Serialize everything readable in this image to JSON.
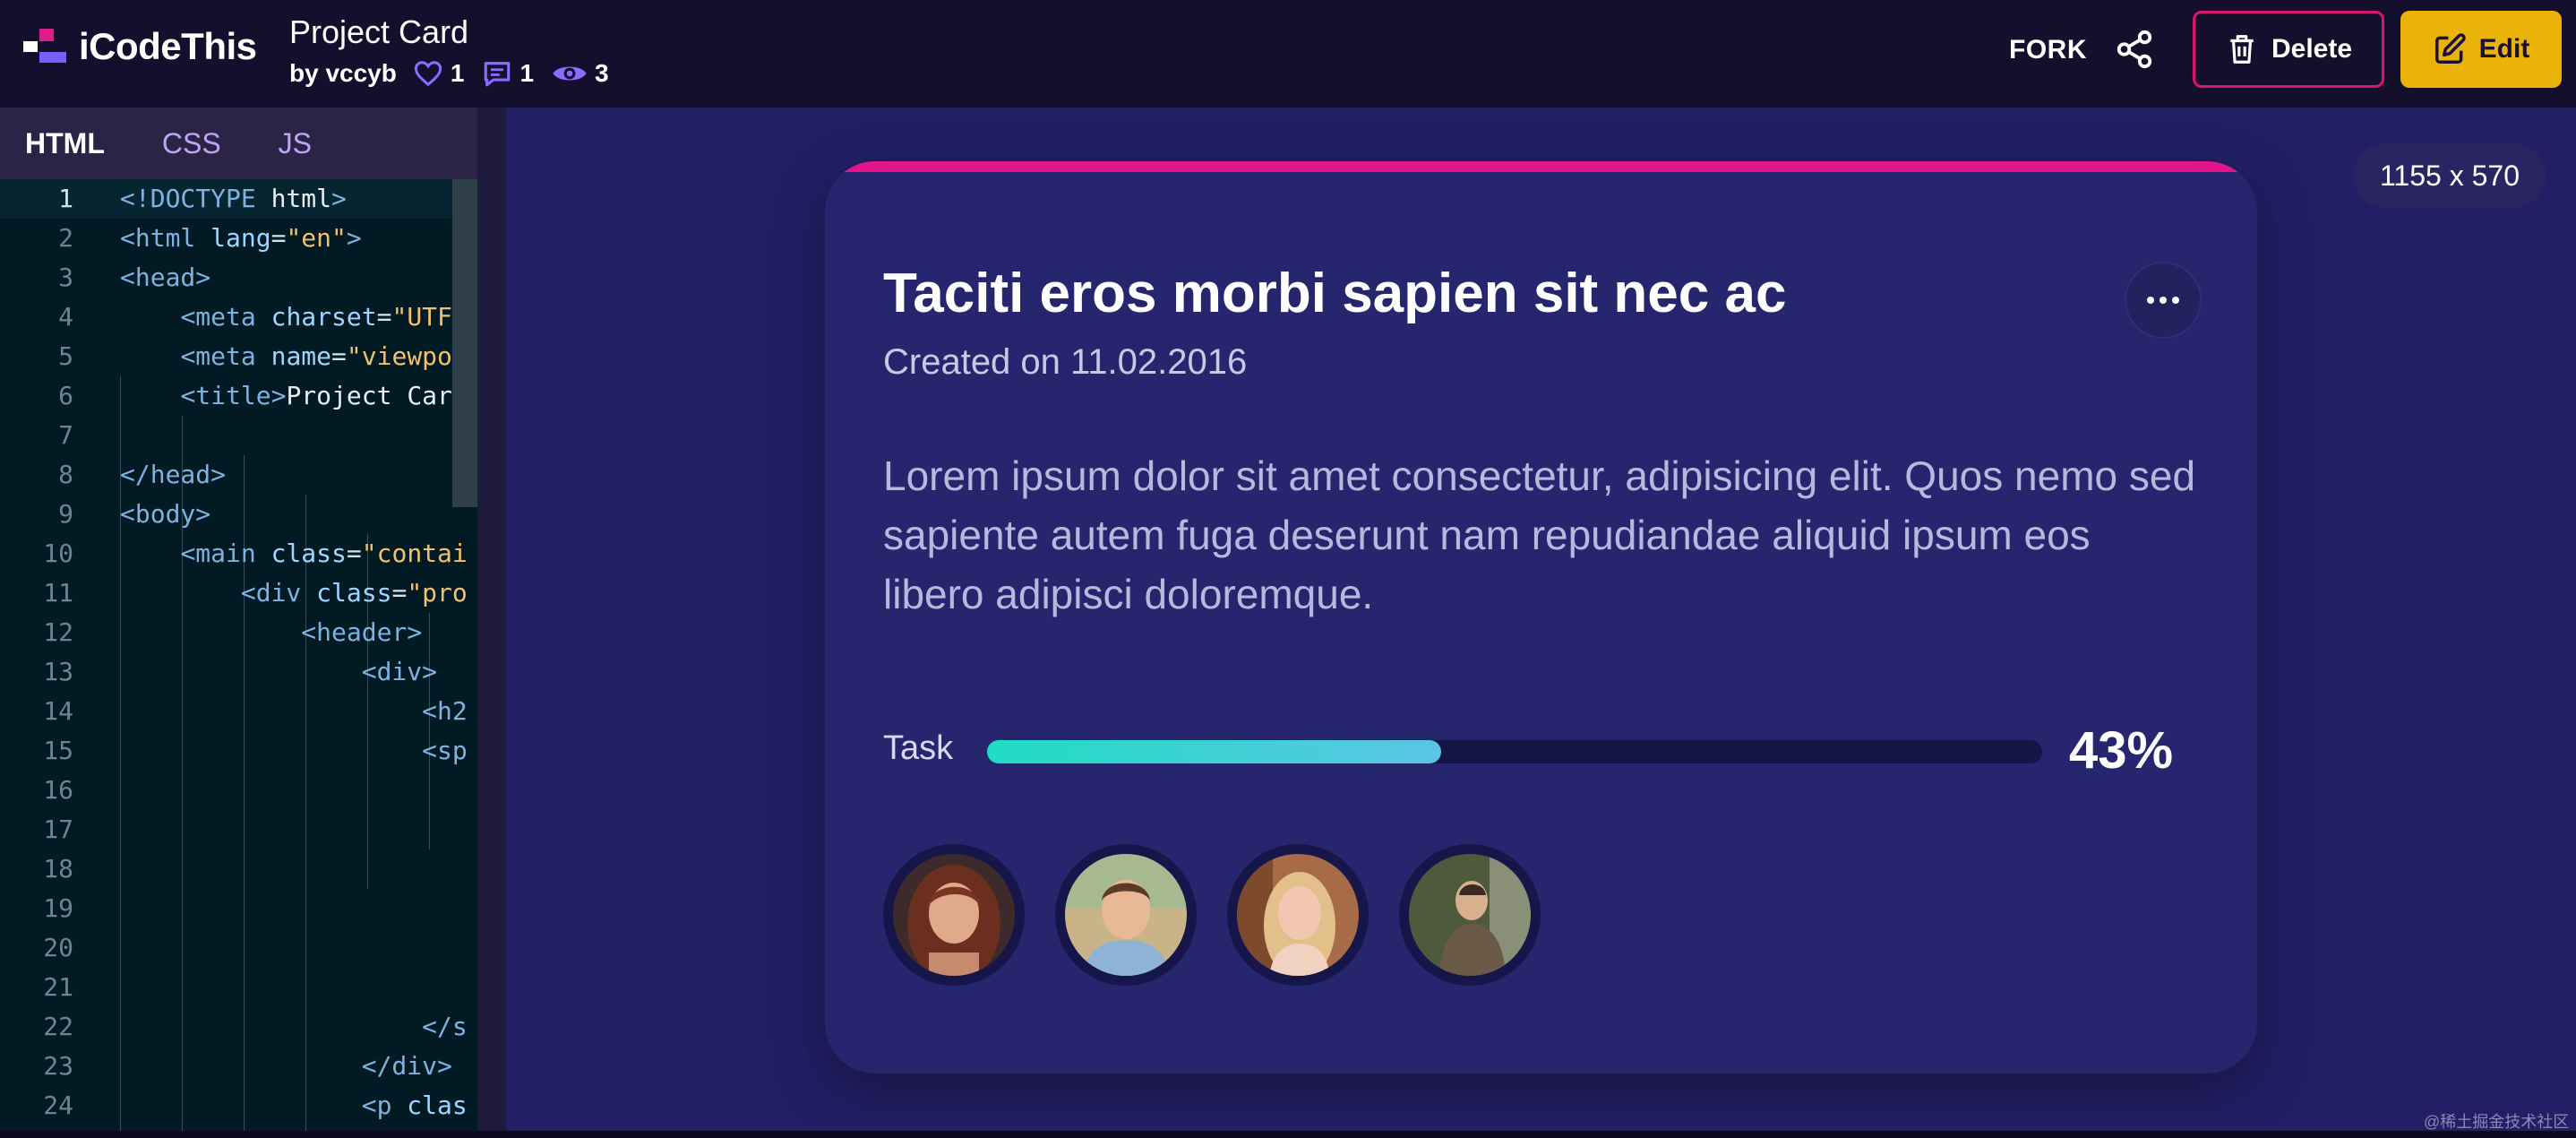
{
  "app": {
    "name": "iCodeThis"
  },
  "project": {
    "title": "Project Card",
    "by": "by vccyb",
    "likes": "1",
    "comments": "1",
    "views": "3"
  },
  "actions": {
    "fork": "FORK",
    "delete": "Delete",
    "edit": "Edit"
  },
  "editor": {
    "tabs": [
      "HTML",
      "CSS",
      "JS"
    ],
    "active_tab": "HTML"
  },
  "preview": {
    "dimensions": "1155 x 570",
    "card": {
      "title": "Taciti eros morbi sapien sit nec ac",
      "date": "Created on 11.02.2016",
      "description": "Lorem ipsum dolor sit amet consectetur, adipisicing elit. Quos nemo sed sapiente autem fuga deserunt nam repudiandae aliquid ipsum eos libero adipisci doloremque.",
      "task_label": "Task",
      "progress_text": "43%",
      "progress": 0.43
    }
  },
  "colors": {
    "accent_pink": "#e4148b",
    "edit_yellow": "#eab308",
    "progress_start": "#20dcc3",
    "progress_end": "#5bc6e6"
  },
  "watermark": "@稀土掘金技术社区"
}
